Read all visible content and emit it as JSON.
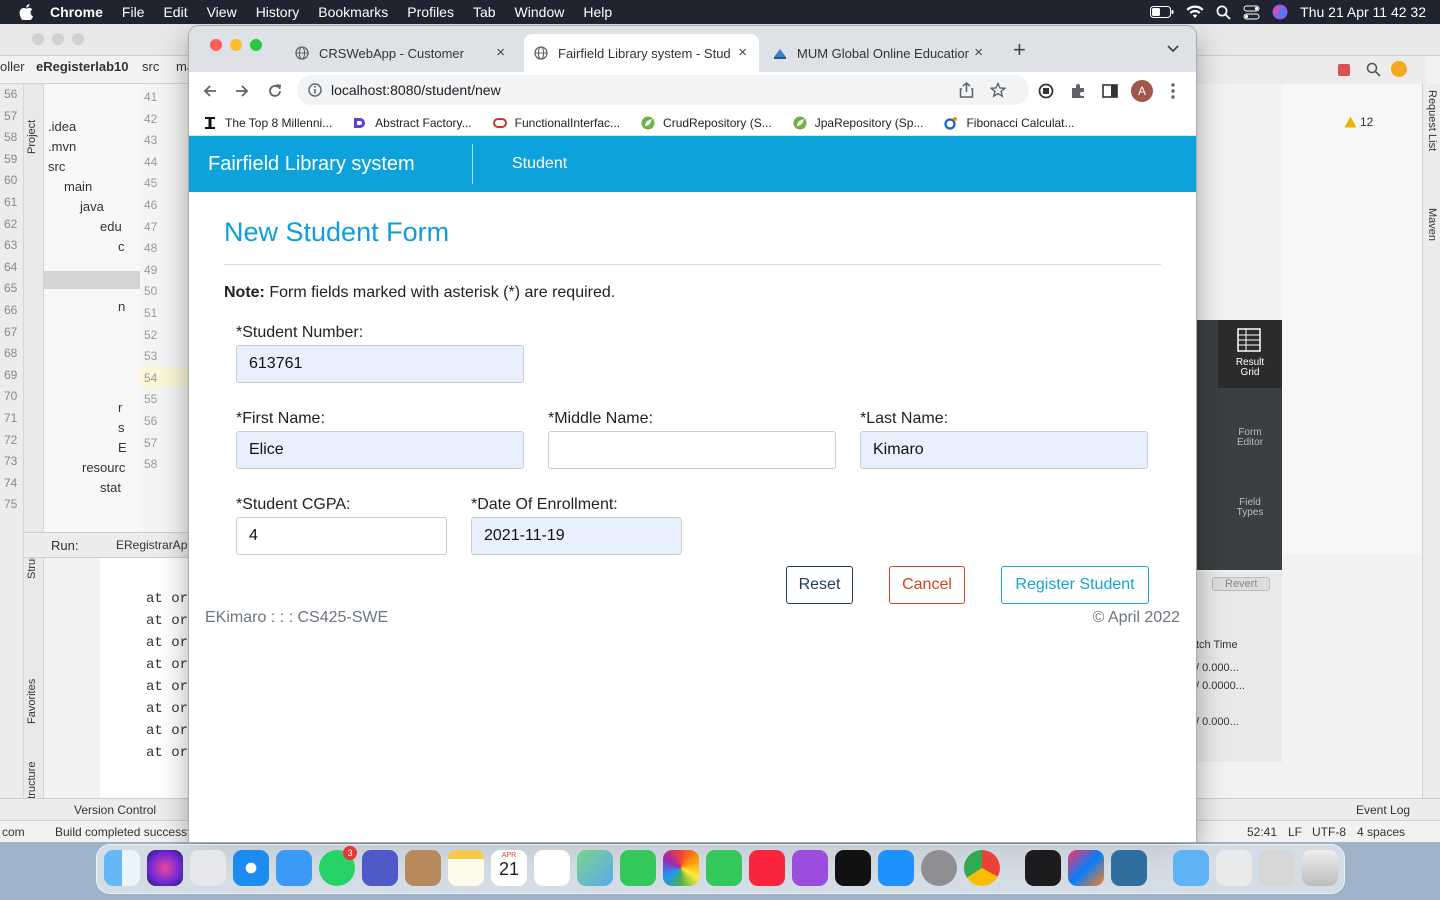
{
  "menubar": {
    "app_name": "Chrome",
    "items": [
      "File",
      "Edit",
      "View",
      "History",
      "Bookmarks",
      "Profiles",
      "Tab",
      "Window",
      "Help"
    ],
    "datetime": "Thu 21 Apr  11 42 32"
  },
  "ide": {
    "project_name": "eRegisterlab10",
    "breadcrumb_src": "src",
    "breadcrumb_rest": "ma",
    "partial_left": "oller",
    "tree": [
      ".idea",
      ".mvn",
      "src",
      "main",
      "java",
      "edu",
      "c",
      "n",
      "r",
      "s",
      "E",
      "resourc",
      "stat"
    ],
    "line_numbers_left": [
      "56",
      "57",
      "58",
      "59",
      "60",
      "61",
      "62",
      "63",
      "64",
      "65",
      "66",
      "67",
      "68",
      "69",
      "70",
      "71",
      "72",
      "73",
      "74",
      "75"
    ],
    "line_numbers_gutter": [
      "41",
      "42",
      "43",
      "44",
      "45",
      "46",
      "47",
      "48",
      "49",
      "50",
      "51",
      "52",
      "53",
      "54",
      "55",
      "56",
      "57",
      "58"
    ],
    "run_label": "Run:",
    "run_config": "ERegistrarAp",
    "console_lines": [
      "at org",
      "at org",
      "at org",
      "at org",
      "at org",
      "at org",
      "at org",
      "at org"
    ],
    "side_tabs": [
      "Project",
      "Structure",
      "Favorites",
      "JPA Structure"
    ],
    "right_tabs": [
      "Request List",
      "Maven"
    ],
    "warnings_count": "12",
    "version_control": "Version Control",
    "event_log": "Event Log",
    "status_build": "Build completed successf",
    "status_left": "com",
    "cursor_pos": "52:41",
    "line_ending": "LF",
    "encoding": "UTF-8",
    "indent": "4 spaces",
    "workbench": {
      "result_grid": "Result Grid",
      "form_editor": "Form Editor",
      "field_types": "Field Types",
      "revert": "Revert",
      "fetch_time": "tch Time",
      "rows": [
        "/ 0.000...",
        "/ 0.0000...",
        "/ 0.000..."
      ]
    }
  },
  "chrome": {
    "tabs": [
      {
        "title": "CRSWebApp - Customer",
        "active": false
      },
      {
        "title": "Fairfield Library system - Stude",
        "active": true
      },
      {
        "title": "MUM Global Online Education",
        "active": false
      }
    ],
    "url": "localhost:8080/student/new",
    "profile_initial": "A",
    "bookmarks": [
      "The Top 8 Millenni...",
      "Abstract Factory...",
      "FunctionalInterfac...",
      "CrudRepository (S...",
      "JpaRepository (Sp...",
      "Fibonacci Calculat..."
    ]
  },
  "page": {
    "brand": "Fairfield Library system",
    "nav_student": "Student",
    "form_title": "New Student Form",
    "note_bold": "Note:",
    "note_text": " Form fields marked with asterisk (*) are required.",
    "fields": {
      "student_number": {
        "label": "*Student Number:",
        "value": "613761"
      },
      "first_name": {
        "label": "*First Name:",
        "value": "Elice"
      },
      "middle_name": {
        "label": "*Middle Name:",
        "value": ""
      },
      "last_name": {
        "label": "*Last Name:",
        "value": "Kimaro"
      },
      "cgpa": {
        "label": "*Student CGPA:",
        "value": "4"
      },
      "enrollment_date": {
        "label": "*Date Of Enrollment:",
        "value": "2021-11-19"
      }
    },
    "buttons": {
      "reset": "Reset",
      "cancel": "Cancel",
      "register": "Register Student"
    },
    "footer_left": "EKimaro : : : CS425-SWE",
    "footer_right": "© April 2022"
  },
  "dock": {
    "calendar_month": "APR",
    "calendar_day": "21",
    "whatsapp_badge": "3",
    "apps": [
      "finder-icon",
      "siri-icon",
      "launchpad-icon",
      "safari-icon",
      "mail-icon",
      "whatsapp-icon",
      "teams-icon",
      "contacts-icon",
      "notes-icon",
      "calendar-icon",
      "reminders-icon",
      "maps-icon",
      "messages-icon",
      "photos-icon",
      "facetime-icon",
      "music-icon",
      "podcasts-icon",
      "appletv-icon",
      "appstore-icon",
      "systemprefs-icon",
      "chrome-icon",
      "terminal-icon",
      "intellij-icon",
      "mysqlworkbench-icon",
      "folder-icon",
      "preview-icon",
      "screenshot-icon",
      "trash-icon"
    ]
  }
}
